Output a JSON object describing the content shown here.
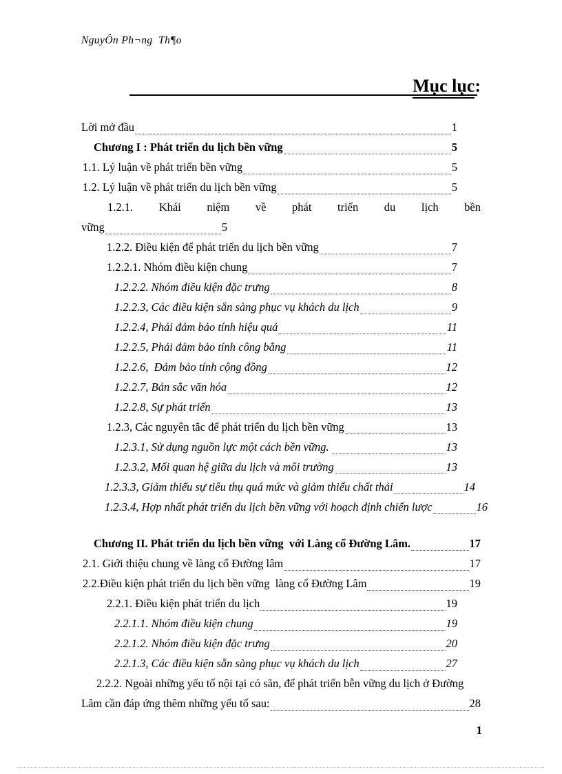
{
  "document": {
    "running_header": "NguyÔn Ph¬ng  Th¶o",
    "title": "Mục lục",
    "title_suffix": ":",
    "page_number": "1"
  },
  "toc": {
    "entries": [
      {
        "label": "Lời mở đầu",
        "page": "1",
        "style": "lv0"
      },
      {
        "label": "Chương I : Phát triển du lịch bền vững",
        "page": "5",
        "style": "lv-chap"
      },
      {
        "label": "1.1. Lý luận về phát triển bền vững",
        "page": "5",
        "style": "lv1"
      },
      {
        "label": "1.2. Lý luận về phát triển du lịch bền vững",
        "page": "5",
        "style": "lv1"
      },
      {
        "label": "1.2.1.    Khái   niệm   về   phát   triển   du   lịch   bền",
        "label_tail": "vững",
        "page": "5",
        "style": "justified"
      },
      {
        "label": "1.2.2. Điều kiện để phát triển du lịch bền vững",
        "page": "7",
        "style": "lv2"
      },
      {
        "label": "1.2.2.1. Nhóm điều kiện chung",
        "page": "7",
        "style": "lv2"
      },
      {
        "label": "1.2.2.2. Nhóm điều kiện đặc trưng",
        "page": "8",
        "style": "lv3"
      },
      {
        "label": "1.2.2.3, Các điều kiện sẵn sàng phục vụ khách du lịch",
        "page": "9",
        "style": "lv3"
      },
      {
        "label": "1.2.2.4, Phải đảm bảo tính hiệu quả",
        "page": "11",
        "style": "lv3"
      },
      {
        "label": "1.2.2.5, Phải đảm bảo tính công bằng",
        "page": "11",
        "style": "lv3"
      },
      {
        "label": "1.2.2.6,  Đảm bảo tính cộng đồng",
        "page": "12",
        "style": "lv3"
      },
      {
        "label": "1.2.2.7, Bản sắc văn hóa",
        "page": "12",
        "style": "lv3"
      },
      {
        "label": "1.2.2.8, Sự phát triển",
        "page": "13",
        "style": "lv3"
      },
      {
        "label": "1.2.3, Các nguyên tắc để phát triển du lịch bền vững",
        "page": "13",
        "style": "lv2"
      },
      {
        "label": "1.2.3.1, Sử dụng nguồn lực một cách bền vững. ",
        "page": "13",
        "style": "lv3"
      },
      {
        "label": "1.2.3.2, Mối quan hệ giữa du lịch và môi trường",
        "page": "13",
        "style": "lv3"
      },
      {
        "label": "1.2.3.3, Giảm thiểu sự tiêu thụ quá mức và giảm thiểu chất thải",
        "page": "14",
        "style": "lv2i"
      },
      {
        "label": "1.2.3.4, Hợp nhất phát triển du lịch bền vững với hoạch định chiến lược",
        "page": "16",
        "style": "lv2i"
      },
      {
        "label": "Chương II. Phát triển du lịch bền vững  với Làng cổ Đường Lâm.",
        "page": "17",
        "style": "lv-chap-wide"
      },
      {
        "label": "2.1. Giới thiệu chung về làng cổ Đường lâm",
        "page": "17",
        "style": "lv1-wide"
      },
      {
        "label": "2.2.Điều kiện phát triển du lịch bền vững  làng cổ Đường Lâm",
        "page": "19",
        "style": "lv1-wide"
      },
      {
        "label": "2.2.1. Điều kiện phát triển du lịch",
        "page": "19",
        "style": "lv2"
      },
      {
        "label": "2.2.1.1. Nhóm điều kiện chung",
        "page": "19",
        "style": "lv3"
      },
      {
        "label": "2.2.1.2. Nhóm điều kiện đặc trưng",
        "page": "20",
        "style": "lv3"
      },
      {
        "label": "2.2.1.3, Các điều kiện sẵn sàng phục vụ khách du lịch",
        "page": "27",
        "style": "lv3"
      },
      {
        "label": "2.2.2. Ngoài những yếu tố nội tại có sãn, để phát triển bễn vững du lịch ở Đường",
        "label_tail": "Lâm cần đáp ứng thêm những yếu tố sau:",
        "page": "28",
        "style": "flow"
      }
    ]
  }
}
